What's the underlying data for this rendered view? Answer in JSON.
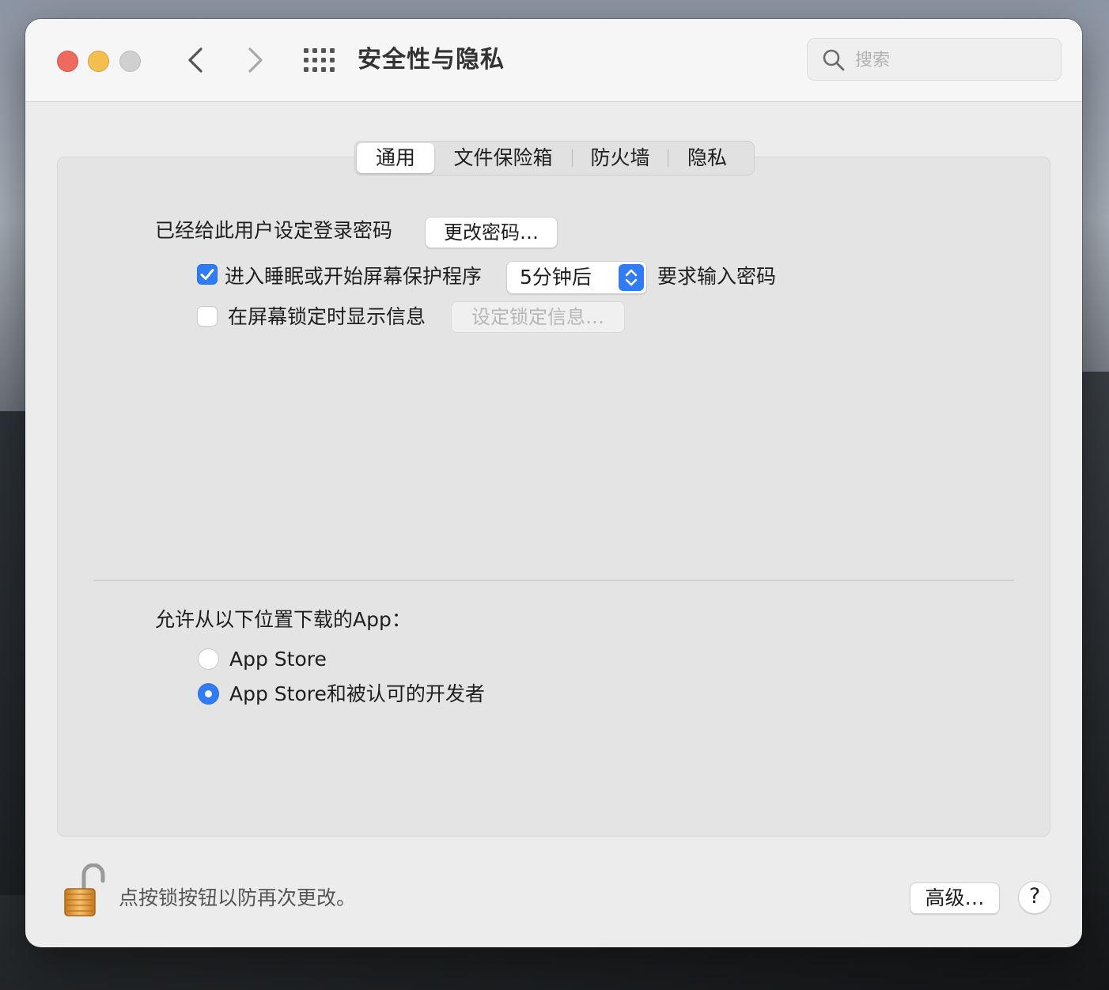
{
  "window": {
    "title": "安全性与隐私",
    "search": {
      "placeholder": "搜索",
      "value": ""
    }
  },
  "tabs": [
    {
      "label": "通用",
      "active": true
    },
    {
      "label": "文件保险箱",
      "active": false
    },
    {
      "label": "防火墙",
      "active": false
    },
    {
      "label": "隐私",
      "active": false
    }
  ],
  "general": {
    "password_label": "已经给此用户设定登录密码",
    "change_password_button": "更改密码…",
    "require_password": {
      "checked": true,
      "label": "进入睡眠或开始屏幕保护程序",
      "delay_value": "5分钟后",
      "suffix": "要求输入密码"
    },
    "lock_message": {
      "checked": false,
      "label": "在屏幕锁定时显示信息",
      "button": "设定锁定信息…"
    }
  },
  "downloads": {
    "label": "允许从以下位置下载的App：",
    "options": [
      {
        "label": "App Store",
        "selected": false
      },
      {
        "label": "App Store和被认可的开发者",
        "selected": true
      }
    ]
  },
  "footer": {
    "lock_text": "点按锁按钮以防再次更改。",
    "advanced_button": "高级…",
    "help_button": "?"
  },
  "colors": {
    "accent": "#2f7cf6",
    "close": "#ed6a5e",
    "minimize": "#f5bf4f",
    "maximize_disabled": "#d0d0d0",
    "lock_gold": "#e9a33c"
  },
  "icons": [
    "chevron-left-icon",
    "chevron-right-icon",
    "grid-icon",
    "search-icon",
    "checkmark-icon",
    "up-down-arrows-icon",
    "unlocked-padlock-icon"
  ]
}
